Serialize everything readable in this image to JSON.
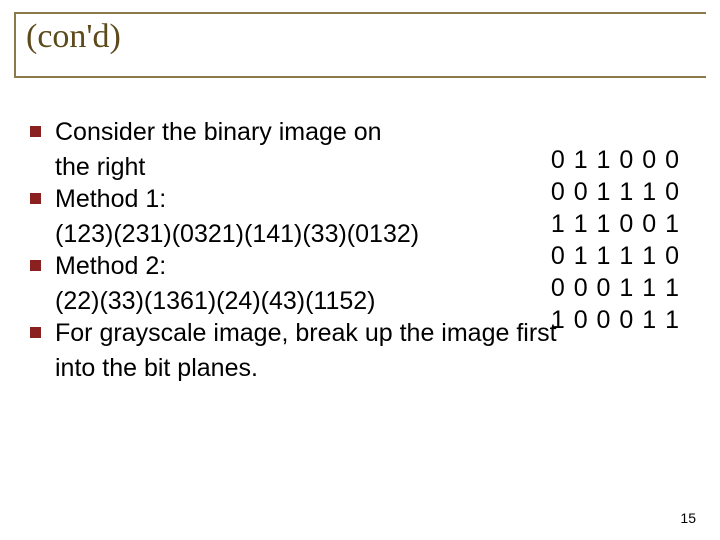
{
  "title": "(con'd)",
  "bullets": [
    {
      "main": "Consider the binary image on",
      "cont": "the right"
    },
    {
      "main": "Method 1:",
      "cont": "(123)(231)(0321)(141)(33)(0132)"
    },
    {
      "main": "Method 2:",
      "cont": "(22)(33)(1361)(24)(43)(1152)"
    },
    {
      "main": "For grayscale image, break up the image first",
      "cont": "into the bit planes."
    }
  ],
  "matrix": [
    "0 1 1 0 0 0",
    "0 0 1 1 1 0",
    "1 1 1 0 0 1",
    "0 1 1 1 1 0",
    "0 0 0 1 1 1",
    "1 0 0 0 1 1"
  ],
  "pageNumber": "15"
}
